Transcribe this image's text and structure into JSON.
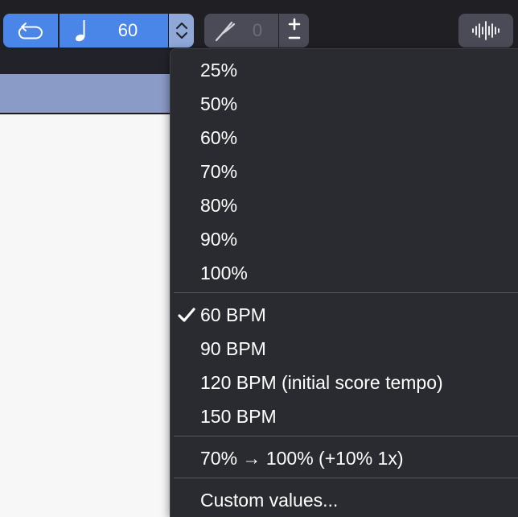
{
  "toolbar": {
    "tempo_value": "60",
    "pitch_value": "0",
    "icons": {
      "loop": "loop-back-icon",
      "note": "quarter-note-icon",
      "stepper": "chevron-up-down-icon",
      "pitch": "tuning-fork-icon",
      "plus_minus": "plus-minus-icon",
      "waveform": "waveform-icon"
    }
  },
  "menu": {
    "percent_items": [
      "25%",
      "50%",
      "60%",
      "70%",
      "80%",
      "90%",
      "100%"
    ],
    "bpm_items": [
      {
        "label": "60 BPM",
        "checked": true
      },
      {
        "label": "90 BPM",
        "checked": false
      },
      {
        "label": "120 BPM (initial score tempo)",
        "checked": false
      },
      {
        "label": "150 BPM",
        "checked": false
      }
    ],
    "ramp_item": "70% → 100% (+10% 1x)",
    "custom_item": "Custom values..."
  },
  "colors": {
    "accent": "#4a86e8",
    "accent_light": "#8fa8d8",
    "menu_bg": "#2a2b31",
    "toolbar_bg": "#1f1f24",
    "header_band": "#8a9bc8"
  }
}
